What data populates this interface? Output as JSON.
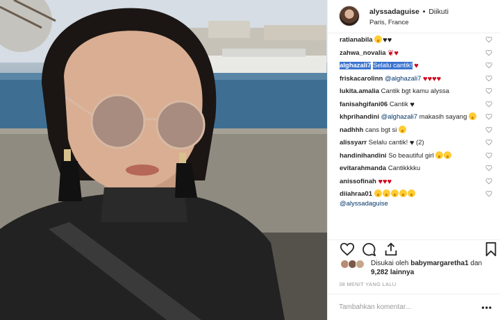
{
  "post": {
    "username": "alyssadaguise",
    "separator": "•",
    "follow_status": "Diikuti",
    "location": "Paris, France"
  },
  "comments": [
    {
      "user": "ratianabila",
      "text": "",
      "emojis": [
        "smile",
        "black-heart",
        "black-heart"
      ]
    },
    {
      "user": "zahwa_novalia",
      "text": "",
      "emojis": [
        "rose",
        "heart"
      ]
    },
    {
      "user": "alghazali7",
      "text": "Selalu cantik!",
      "emojis": [
        "heart"
      ],
      "highlighted": true
    },
    {
      "user": "friskacarolinn",
      "mention": "@alghazali7",
      "text": "",
      "emojis": [
        "heart",
        "heart",
        "heart",
        "heart"
      ]
    },
    {
      "user": "lukita.amalia",
      "text": "Cantik bgt kamu alyssa",
      "emojis": []
    },
    {
      "user": "fanisahgifani06",
      "text": "Cantik",
      "emojis": [
        "black-heart"
      ]
    },
    {
      "user": "khprihandini",
      "mention": "@alghazali7",
      "text": "makasih sayang",
      "emojis": [
        "smile"
      ]
    },
    {
      "user": "nadhhh",
      "text": "cans bgt si",
      "emojis": [
        "smile"
      ]
    },
    {
      "user": "alissyarr",
      "text": "Selalu cantik!",
      "emojis": [
        "black-heart"
      ],
      "suffix": "(2)"
    },
    {
      "user": "handinihandini",
      "text": "So beautiful girl",
      "emojis": [
        "heart-eyes",
        "heart-eyes"
      ]
    },
    {
      "user": "evitarahmanda",
      "text": "Cantikkkku",
      "emojis": []
    },
    {
      "user": "anissofinah",
      "text": "",
      "emojis": [
        "heart",
        "heart",
        "heart"
      ]
    },
    {
      "user": "diiahraa01",
      "text": "",
      "emojis": [
        "heart-eyes",
        "heart-eyes",
        "heart-eyes",
        "heart-eyes",
        "heart-eyes"
      ],
      "mention_after": "@alyssadaguise"
    }
  ],
  "actions": {
    "like_icon": "heart-outline-icon",
    "comment_icon": "comment-icon",
    "share_icon": "share-icon",
    "save_icon": "bookmark-icon"
  },
  "likes": {
    "prefix": "Disukai oleh",
    "user": "babymargaretha1",
    "connector": "dan",
    "count": "9,282",
    "suffix": "lainnya"
  },
  "timestamp": "38 MENIT YANG LALU",
  "add_comment": {
    "placeholder": "Tambahkan komentar...",
    "more": "•••"
  },
  "colors": {
    "heart_red": "#d0021b",
    "highlight_blue": "#3a74d0",
    "mention_blue": "#003569",
    "muted": "#999999"
  }
}
